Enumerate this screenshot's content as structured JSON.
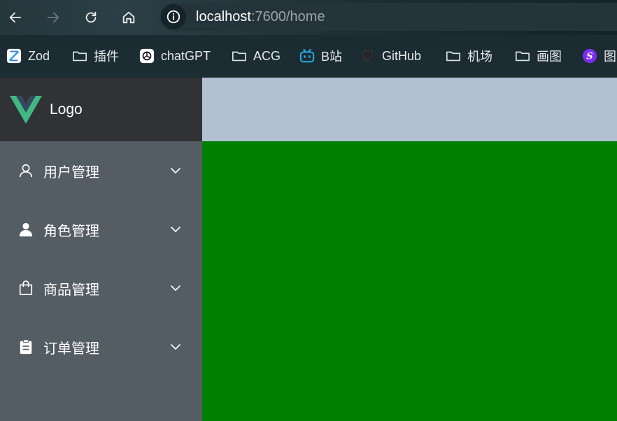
{
  "browser": {
    "url_host": "localhost",
    "url_rest": ":7600/home"
  },
  "bookmarks": [
    {
      "label": "Zod",
      "icon": "zod-icon"
    },
    {
      "label": "插件",
      "icon": "folder-icon"
    },
    {
      "label": "chatGPT",
      "icon": "openai-icon"
    },
    {
      "label": "ACG",
      "icon": "folder-icon"
    },
    {
      "label": "B站",
      "icon": "bilibili-icon"
    },
    {
      "label": "GitHub",
      "icon": "github-icon"
    },
    {
      "label": "机场",
      "icon": "folder-icon"
    },
    {
      "label": "画图",
      "icon": "folder-icon"
    },
    {
      "label": "图",
      "icon": "s-logo-icon"
    }
  ],
  "sidebar": {
    "logo_text": "Logo",
    "items": [
      {
        "label": "用户管理",
        "icon": "user-outline-icon"
      },
      {
        "label": "角色管理",
        "icon": "user-filled-icon"
      },
      {
        "label": "商品管理",
        "icon": "shopping-bag-icon"
      },
      {
        "label": "订单管理",
        "icon": "clipboard-icon"
      }
    ]
  },
  "colors": {
    "sidebar_bg": "#545c64",
    "logo_bar_bg": "#313236",
    "header_bg": "#b3c0d1",
    "main_bg": "#008000",
    "vue_green": "#41b883",
    "vue_dark": "#35495e"
  }
}
